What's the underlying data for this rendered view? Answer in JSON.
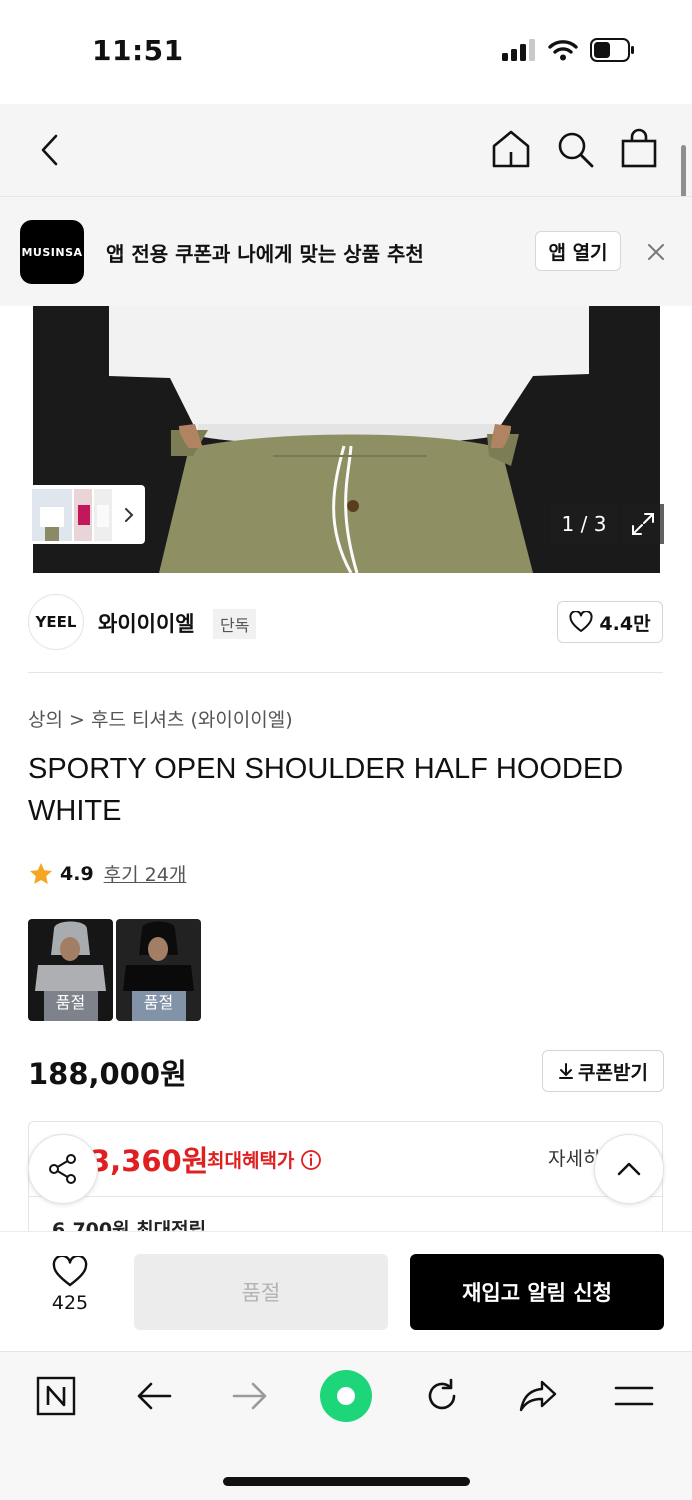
{
  "status_bar": {
    "time": "11:51"
  },
  "app_banner": {
    "logo_text": "MUSINSA",
    "message": "앱 전용 쿠폰과 나에게 맞는 상품 추천",
    "open_label": "앱 열기"
  },
  "gallery": {
    "page_indicator": "1 / 3"
  },
  "brand": {
    "logo_text": "YEEL",
    "name": "와이이이엘",
    "tag": "단독",
    "likes": "4.4만"
  },
  "product": {
    "breadcrumb": "상의 > 후드 티셔츠 (와이이이엘)",
    "title": "SPORTY OPEN SHOULDER HALF HOODED WHITE",
    "rating": "4.9",
    "reviews": "후기 24개",
    "variants": [
      {
        "label": "품절"
      },
      {
        "label": "품절"
      }
    ],
    "price": "188,000원",
    "coupon_label": "쿠폰받기"
  },
  "benefit": {
    "max_price": "3,360원",
    "max_label": "최대혜택가",
    "detail_label": "자세히",
    "points": "6,700원 최대적립"
  },
  "purchase_bar": {
    "wish_count": "425",
    "soldout_label": "품절",
    "restock_label": "재입고 알림 신청"
  },
  "colors": {
    "accent_red": "#e02020",
    "primary_black": "#000000",
    "star": "#f5a623",
    "browser_green": "#1ed67a"
  }
}
